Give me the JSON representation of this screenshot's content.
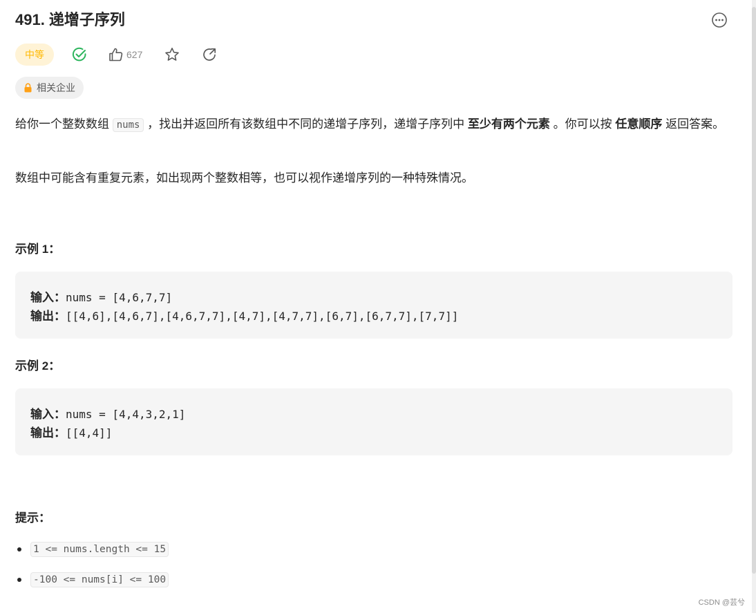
{
  "problem": {
    "title": "491. 递增子序列",
    "difficulty": "中等",
    "likes": "627",
    "company_tag": "相关企业"
  },
  "description": {
    "p1_a": "给你一个整数数组 ",
    "p1_code": "nums",
    "p1_b": " ，找出并返回所有该数组中不同的递增子序列，递增子序列中 ",
    "p1_bold1": "至少有两个元素",
    "p1_c": " 。你可以按 ",
    "p1_bold2": "任意顺序",
    "p1_d": " 返回答案。",
    "p2": "数组中可能含有重复元素，如出现两个整数相等，也可以视作递增序列的一种特殊情况。"
  },
  "examples": [
    {
      "title": "示例 1：",
      "input_label": "输入：",
      "input": "nums = [4,6,7,7]",
      "output_label": "输出：",
      "output": "[[4,6],[4,6,7],[4,6,7,7],[4,7],[4,7,7],[6,7],[6,7,7],[7,7]]"
    },
    {
      "title": "示例 2：",
      "input_label": "输入：",
      "input": "nums = [4,4,3,2,1]",
      "output_label": "输出：",
      "output": "[[4,4]]"
    }
  ],
  "hints": {
    "title": "提示：",
    "items": [
      "1 <= nums.length <= 15",
      "-100 <= nums[i] <= 100"
    ]
  },
  "watermark": "CSDN @芸兮",
  "colors": {
    "difficulty_text": "#ffb800",
    "difficulty_bg": "#fff3d6",
    "solved_check": "#2db55d",
    "lock": "#ffa116"
  },
  "icons": [
    "more-icon",
    "solved-check-icon",
    "thumbs-up-icon",
    "star-icon",
    "share-icon",
    "lock-icon"
  ]
}
